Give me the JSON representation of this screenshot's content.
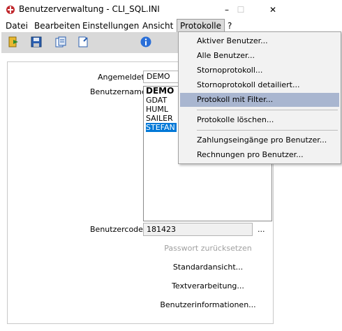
{
  "window": {
    "title": "Benutzerverwaltung - CLI_SQL.INI",
    "minimize": "–",
    "maximize": "☐",
    "close": "✕"
  },
  "menubar": {
    "items": [
      "Datei",
      "Bearbeiten",
      "Einstellungen",
      "Ansicht",
      "Protokolle",
      "?"
    ]
  },
  "toolbar": {
    "icons": [
      "exit-icon",
      "save-icon",
      "copy-icon",
      "new-icon",
      "info-icon"
    ]
  },
  "form": {
    "logged_in_label": "Angemeldet:",
    "logged_in_value": "DEMO",
    "username_label": "Benutzername:",
    "users": [
      "DEMO",
      "GDAT",
      "HUML",
      "SAILER",
      "STEFAN"
    ],
    "selected_user": "STEFAN",
    "usercode_label": "Benutzercode:",
    "usercode_value": "181423",
    "usercode_dots": "...",
    "reset_password": "Passwort zurücksetzen",
    "standard_view": "Standardansicht...",
    "text_processing": "Textverarbeitung...",
    "user_info": "Benutzerinformationen..."
  },
  "protokolle_menu": {
    "items": [
      "Aktiver Benutzer...",
      "Alle Benutzer...",
      "Stornoprotokoll...",
      "Stornoprotokoll detailiert...",
      "Protokoll mit Filter...",
      "Protokolle löschen...",
      "Zahlungseingänge pro Benutzer...",
      "Rechnungen pro Benutzer..."
    ],
    "highlighted": "Protokoll mit Filter..."
  },
  "colors": {
    "highlight": "#a9b6d0",
    "selection": "#0078d7",
    "toolbar": "#d9d9d9"
  }
}
